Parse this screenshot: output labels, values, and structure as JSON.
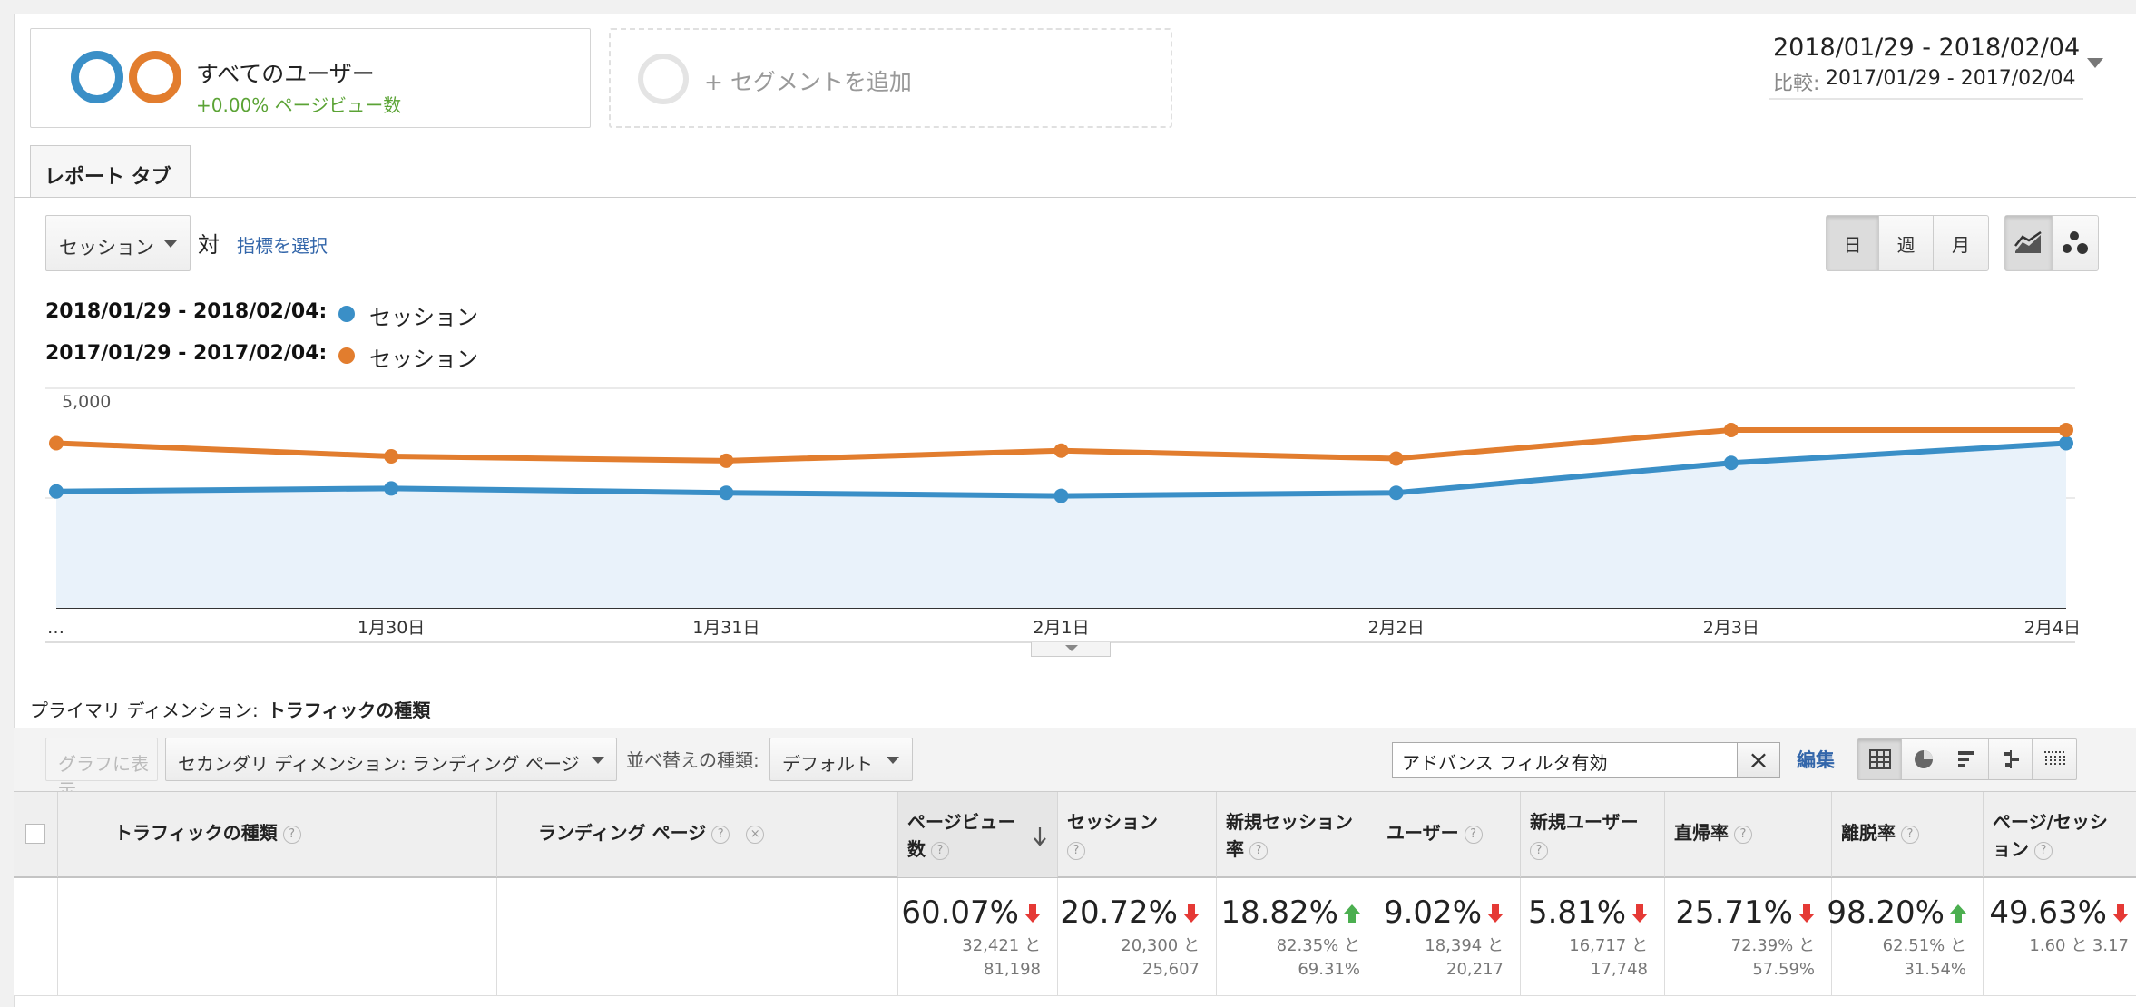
{
  "segments": {
    "active": {
      "title": "すべてのユーザー",
      "subtitle": "+0.00% ページビュー数"
    },
    "add_label": "+ セグメントを追加"
  },
  "date_range": {
    "main": "2018/01/29 - 2018/02/04",
    "compare_label": "比較:",
    "compare": "2017/01/29 - 2017/02/04"
  },
  "report_tab": "レポート タブ",
  "metric": {
    "selected": "セッション",
    "vs": "対",
    "choose_link": "指標を選択"
  },
  "granularity": {
    "day": "日",
    "week": "週",
    "month": "月",
    "active": "day"
  },
  "legend": [
    {
      "date": "2018/01/29 - 2018/02/04:",
      "metric": "セッション",
      "color": "#3a8fc7"
    },
    {
      "date": "2017/01/29 - 2017/02/04:",
      "metric": "セッション",
      "color": "#e27d2e"
    }
  ],
  "chart_data": {
    "type": "line",
    "categories": [
      "…",
      "1月30日",
      "1月31日",
      "2月1日",
      "2月2日",
      "2月3日",
      "2月4日"
    ],
    "y_ticks": [
      "5,000",
      "2,500"
    ],
    "ylim": [
      0,
      5000
    ],
    "grid": true,
    "series": [
      {
        "name": "2018/01/29 - 2018/02/04",
        "color": "#3a8fc7",
        "values": [
          2650,
          2720,
          2620,
          2550,
          2620,
          3300,
          3750
        ],
        "area": true
      },
      {
        "name": "2017/01/29 - 2017/02/04",
        "color": "#e27d2e",
        "values": [
          3750,
          3450,
          3350,
          3580,
          3400,
          4050,
          4050
        ]
      }
    ]
  },
  "primary_dimension": {
    "label": "プライマリ ディメンション:",
    "value": "トラフィックの種類"
  },
  "toolbar": {
    "plot_button": "グラフに表示",
    "secondary_dimension": "セカンダリ ディメンション: ランディング ページ",
    "sort_label": "並べ替えの種類:",
    "sort_value": "デフォルト",
    "filter_value": "アドバンス フィルタ有効",
    "edit_link": "編集"
  },
  "table": {
    "columns": [
      {
        "label": "トラフィックの種類"
      },
      {
        "label": "ランディング ページ"
      },
      {
        "label_line1": "ページビュー",
        "label_line2": "数",
        "sorted": true
      },
      {
        "label_line1": "セッション",
        "label_line2": ""
      },
      {
        "label_line1": "新規セッション",
        "label_line2": "率"
      },
      {
        "label_line1": "ユーザー",
        "label_line2": ""
      },
      {
        "label_line1": "新規ユーザー",
        "label_line2": ""
      },
      {
        "label_line1": "直帰率",
        "label_line2": ""
      },
      {
        "label_line1": "離脱率",
        "label_line2": ""
      },
      {
        "label_line1": "ページ/セッシ",
        "label_line2": "ョン"
      }
    ],
    "summary": [
      {
        "pct": "60.07%",
        "dir": "down",
        "cmp1": "32,421 と",
        "cmp2": "81,198"
      },
      {
        "pct": "20.72%",
        "dir": "down",
        "cmp1": "20,300 と",
        "cmp2": "25,607"
      },
      {
        "pct": "18.82%",
        "dir": "up",
        "cmp1": "82.35% と",
        "cmp2": "69.31%"
      },
      {
        "pct": "9.02%",
        "dir": "down",
        "cmp1": "18,394 と",
        "cmp2": "20,217"
      },
      {
        "pct": "5.81%",
        "dir": "down",
        "cmp1": "16,717 と",
        "cmp2": "17,748"
      },
      {
        "pct": "25.71%",
        "dir": "down",
        "cmp1": "72.39% と",
        "cmp2": "57.59%"
      },
      {
        "pct": "98.20%",
        "dir": "up",
        "cmp1": "62.51% と",
        "cmp2": "31.54%"
      },
      {
        "pct": "49.63%",
        "dir": "down",
        "cmp1": "1.60 と 3.17",
        "cmp2": ""
      }
    ]
  }
}
